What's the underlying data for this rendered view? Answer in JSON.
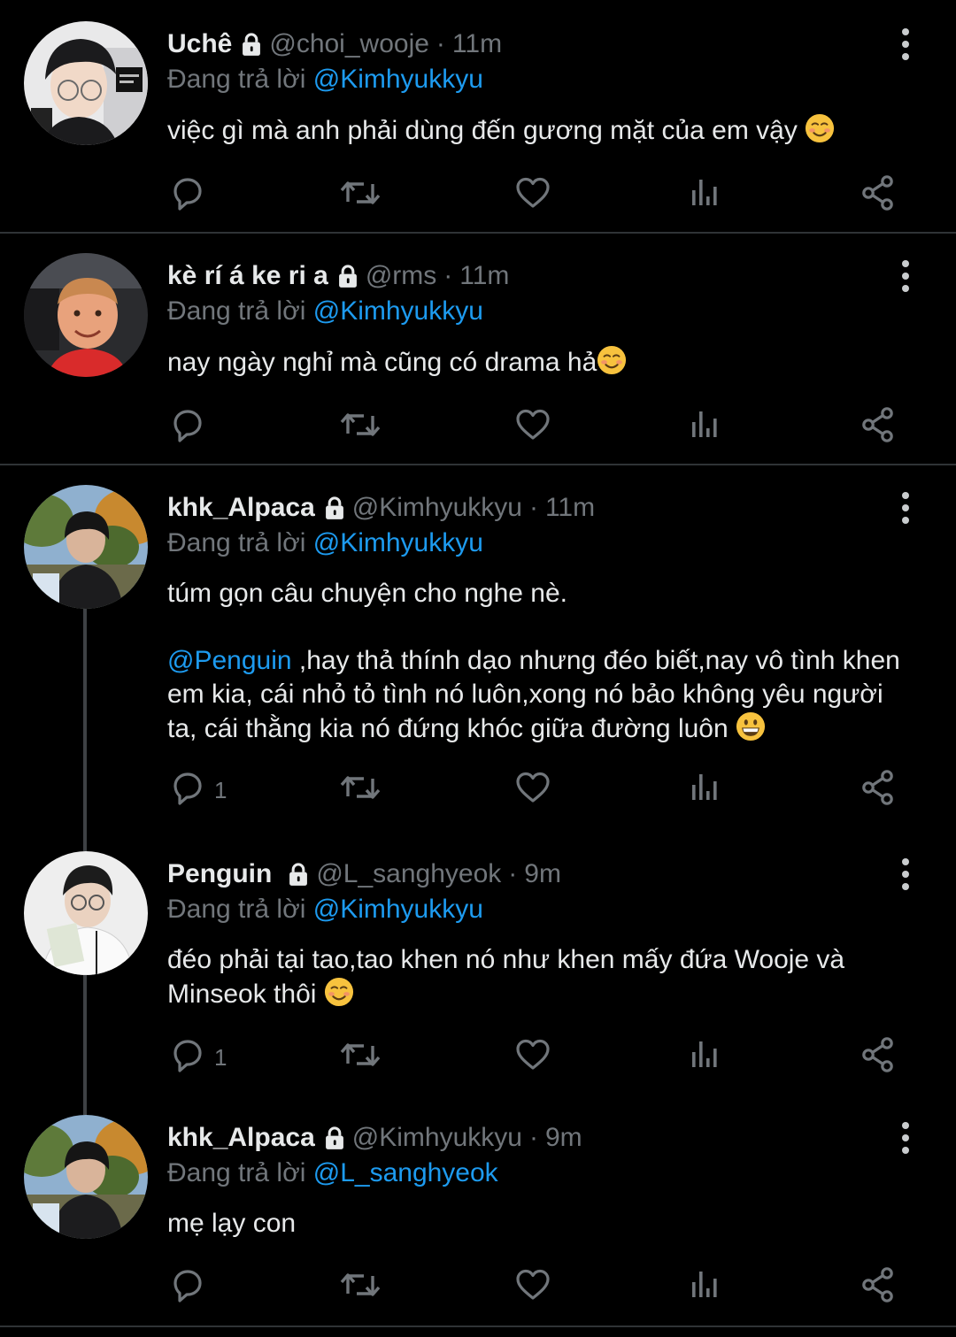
{
  "reply_prefix": "Đang trả lời",
  "tweets": [
    {
      "name": "Uchê",
      "handle": "@choi_wooje",
      "time": "11m",
      "reply_to": "@Kimhyukkyu",
      "text": "việc gì mà anh phải dùng đến gương mặt của em vậy",
      "emoji": "smiling-face-icon",
      "reply_count": ""
    },
    {
      "name": "kè rí á ke ri a",
      "handle": "@rms",
      "time": "11m",
      "reply_to": "@Kimhyukkyu",
      "text": "nay ngày nghỉ mà cũng có drama hả",
      "emoji": "smiling-face-icon",
      "reply_count": ""
    },
    {
      "name": "khk_Alpaca",
      "handle": "@Kimhyukkyu",
      "time": "11m",
      "reply_to": "@Kimhyukkyu",
      "text_first": "túm gọn câu chuyện cho nghe nè.",
      "text_mention": "@Penguin",
      "text_rest": " ,hay thả thính dạo nhưng đéo biết,nay vô tình khen em kia, cái nhỏ tỏ tình nó luôn,xong nó bảo không yêu người ta, cái thằng kia nó đứng khóc giữa đường luôn",
      "emoji": "grinning-face-icon",
      "reply_count": "1"
    },
    {
      "name": "Penguin",
      "handle": "@L_sanghyeok",
      "time": "9m",
      "reply_to": "@Kimhyukkyu",
      "text": "đéo phải tại tao,tao khen nó như khen mấy đứa Wooje và Minseok thôi",
      "emoji": "smiling-face-icon",
      "reply_count": "1"
    },
    {
      "name": "khk_Alpaca",
      "handle": "@Kimhyukkyu",
      "time": "9m",
      "reply_to": "@L_sanghyeok",
      "text": "mẹ lạy con",
      "emoji": "",
      "reply_count": ""
    }
  ],
  "colors": {
    "background": "#000000",
    "text": "#e7e9ea",
    "secondary": "#71767b",
    "accent": "#1d9bf0",
    "separator": "#2f3336"
  },
  "icons": [
    "lock-icon",
    "more-vertical-icon",
    "reply-icon",
    "retweet-icon",
    "like-icon",
    "views-icon",
    "share-icon"
  ]
}
